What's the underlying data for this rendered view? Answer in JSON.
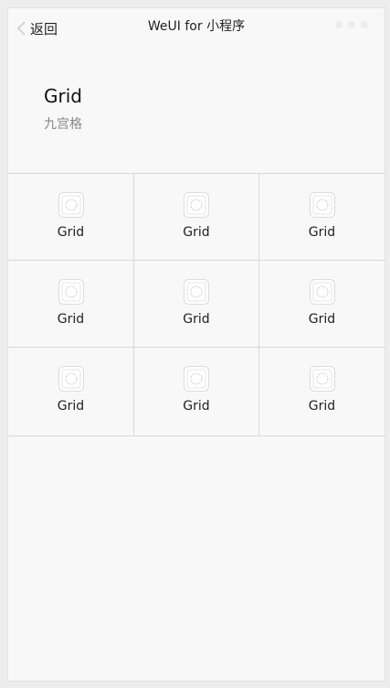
{
  "navbar": {
    "back_label": "返回",
    "title": "WeUI for 小程序",
    "menu_icon": "more-dots-icon"
  },
  "header": {
    "title": "Grid",
    "desc": "九宫格"
  },
  "grid": {
    "icon": "grid-placeholder-icon",
    "items": [
      {
        "label": "Grid"
      },
      {
        "label": "Grid"
      },
      {
        "label": "Grid"
      },
      {
        "label": "Grid"
      },
      {
        "label": "Grid"
      },
      {
        "label": "Grid"
      },
      {
        "label": "Grid"
      },
      {
        "label": "Grid"
      },
      {
        "label": "Grid"
      }
    ]
  }
}
